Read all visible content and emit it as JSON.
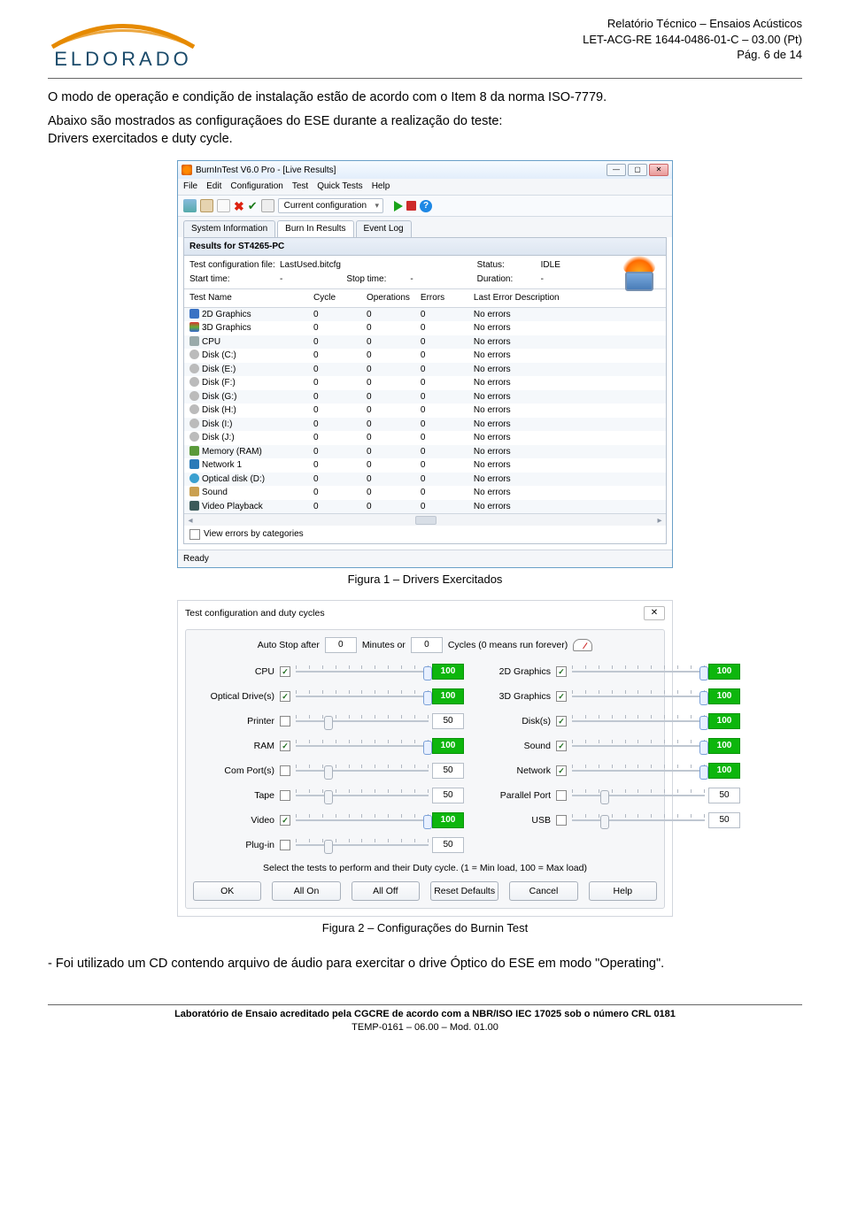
{
  "header": {
    "logo_text": "ELDORADO",
    "r1": "Relatório Técnico – Ensaios Acústicos",
    "r2": "LET-ACG-RE 1644-0486-01-C – 03.00 (Pt)",
    "r3": "Pág. 6 de 14"
  },
  "intro": {
    "p1": "O modo de operação e condição de instalação estão de acordo com o Item 8 da norma ISO-7779.",
    "p2": "Abaixo são mostrados as configuraçãoes do ESE durante a realização do teste:",
    "p3": "Drivers exercitados e duty cycle."
  },
  "win": {
    "title": "BurnInTest V6.0 Pro - [Live Results]",
    "menu": [
      "File",
      "Edit",
      "Configuration",
      "Test",
      "Quick Tests",
      "Help"
    ],
    "toolbar_config": "Current configuration",
    "tabs": [
      {
        "label": "System Information",
        "active": false
      },
      {
        "label": "Burn In Results",
        "active": true
      },
      {
        "label": "Event Log",
        "active": false
      }
    ],
    "results_for": "Results for ST4265-PC",
    "meta": {
      "tcf_label": "Test configuration file:",
      "tcf_value": "LastUsed.bitcfg",
      "start_label": "Start time:",
      "start_value": "-",
      "stop_label": "Stop time:",
      "stop_value": "-",
      "status_label": "Status:",
      "status_value": "IDLE",
      "dur_label": "Duration:",
      "dur_value": "-"
    },
    "cols": [
      "Test Name",
      "Cycle",
      "Operations",
      "Errors",
      "Last Error Description"
    ],
    "rows": [
      {
        "icon": "ri-2d",
        "name": "2D Graphics",
        "c": "0",
        "o": "0",
        "e": "0",
        "d": "No errors"
      },
      {
        "icon": "ri-3d",
        "name": "3D Graphics",
        "c": "0",
        "o": "0",
        "e": "0",
        "d": "No errors"
      },
      {
        "icon": "ri-cpu",
        "name": "CPU",
        "c": "0",
        "o": "0",
        "e": "0",
        "d": "No errors"
      },
      {
        "icon": "ri-disk",
        "name": "Disk (C:)",
        "c": "0",
        "o": "0",
        "e": "0",
        "d": "No errors"
      },
      {
        "icon": "ri-disk",
        "name": "Disk (E:)",
        "c": "0",
        "o": "0",
        "e": "0",
        "d": "No errors"
      },
      {
        "icon": "ri-disk",
        "name": "Disk (F:)",
        "c": "0",
        "o": "0",
        "e": "0",
        "d": "No errors"
      },
      {
        "icon": "ri-disk",
        "name": "Disk (G:)",
        "c": "0",
        "o": "0",
        "e": "0",
        "d": "No errors"
      },
      {
        "icon": "ri-disk",
        "name": "Disk (H:)",
        "c": "0",
        "o": "0",
        "e": "0",
        "d": "No errors"
      },
      {
        "icon": "ri-disk",
        "name": "Disk (I:)",
        "c": "0",
        "o": "0",
        "e": "0",
        "d": "No errors"
      },
      {
        "icon": "ri-disk",
        "name": "Disk (J:)",
        "c": "0",
        "o": "0",
        "e": "0",
        "d": "No errors"
      },
      {
        "icon": "ri-ram",
        "name": "Memory (RAM)",
        "c": "0",
        "o": "0",
        "e": "0",
        "d": "No errors"
      },
      {
        "icon": "ri-net",
        "name": "Network 1",
        "c": "0",
        "o": "0",
        "e": "0",
        "d": "No errors"
      },
      {
        "icon": "ri-opt",
        "name": "Optical disk (D:)",
        "c": "0",
        "o": "0",
        "e": "0",
        "d": "No errors"
      },
      {
        "icon": "ri-snd",
        "name": "Sound",
        "c": "0",
        "o": "0",
        "e": "0",
        "d": "No errors"
      },
      {
        "icon": "ri-vid",
        "name": "Video Playback",
        "c": "0",
        "o": "0",
        "e": "0",
        "d": "No errors"
      }
    ],
    "view_errors": "View errors by categories",
    "status": "Ready"
  },
  "cap1": "Figura 1 – Drivers Exercitados",
  "dlg": {
    "title": "Test configuration and duty cycles",
    "autostop": {
      "label": "Auto Stop after",
      "v1": "0",
      "mid": "Minutes or",
      "v2": "0",
      "tail": "Cycles (0 means run forever)"
    },
    "rows_left": [
      {
        "label": "CPU",
        "checked": true,
        "pos": 100,
        "val": "100",
        "green": true
      },
      {
        "label": "Optical Drive(s)",
        "checked": true,
        "pos": 100,
        "val": "100",
        "green": true
      },
      {
        "label": "Printer",
        "checked": false,
        "pos": 25,
        "val": "50",
        "green": false
      },
      {
        "label": "RAM",
        "checked": true,
        "pos": 100,
        "val": "100",
        "green": true
      },
      {
        "label": "Com Port(s)",
        "checked": false,
        "pos": 25,
        "val": "50",
        "green": false
      },
      {
        "label": "Tape",
        "checked": false,
        "pos": 25,
        "val": "50",
        "green": false
      },
      {
        "label": "Video",
        "checked": true,
        "pos": 100,
        "val": "100",
        "green": true
      },
      {
        "label": "Plug-in",
        "checked": false,
        "pos": 25,
        "val": "50",
        "green": false
      }
    ],
    "rows_right": [
      {
        "label": "2D Graphics",
        "checked": true,
        "pos": 100,
        "val": "100",
        "green": true
      },
      {
        "label": "3D Graphics",
        "checked": true,
        "pos": 100,
        "val": "100",
        "green": true
      },
      {
        "label": "Disk(s)",
        "checked": true,
        "pos": 100,
        "val": "100",
        "green": true
      },
      {
        "label": "Sound",
        "checked": true,
        "pos": 100,
        "val": "100",
        "green": true
      },
      {
        "label": "Network",
        "checked": true,
        "pos": 100,
        "val": "100",
        "green": true
      },
      {
        "label": "Parallel Port",
        "checked": false,
        "pos": 25,
        "val": "50",
        "green": false
      },
      {
        "label": "USB",
        "checked": false,
        "pos": 25,
        "val": "50",
        "green": false
      }
    ],
    "hint": "Select the tests to perform and their Duty cycle. (1 = Min load, 100 = Max load)",
    "buttons": [
      "OK",
      "All On",
      "All Off",
      "Reset Defaults",
      "Cancel",
      "Help"
    ]
  },
  "cap2": "Figura 2 – Configurações do Burnin Test",
  "outro": "- Foi utilizado um CD contendo arquivo de áudio para exercitar o drive Óptico do ESE em modo \"Operating\".",
  "footer": {
    "f1": "Laboratório de Ensaio acreditado pela CGCRE de acordo com a NBR/ISO IEC 17025 sob o número CRL 0181",
    "f2": "TEMP-0161 – 06.00 – Mod. 01.00"
  }
}
